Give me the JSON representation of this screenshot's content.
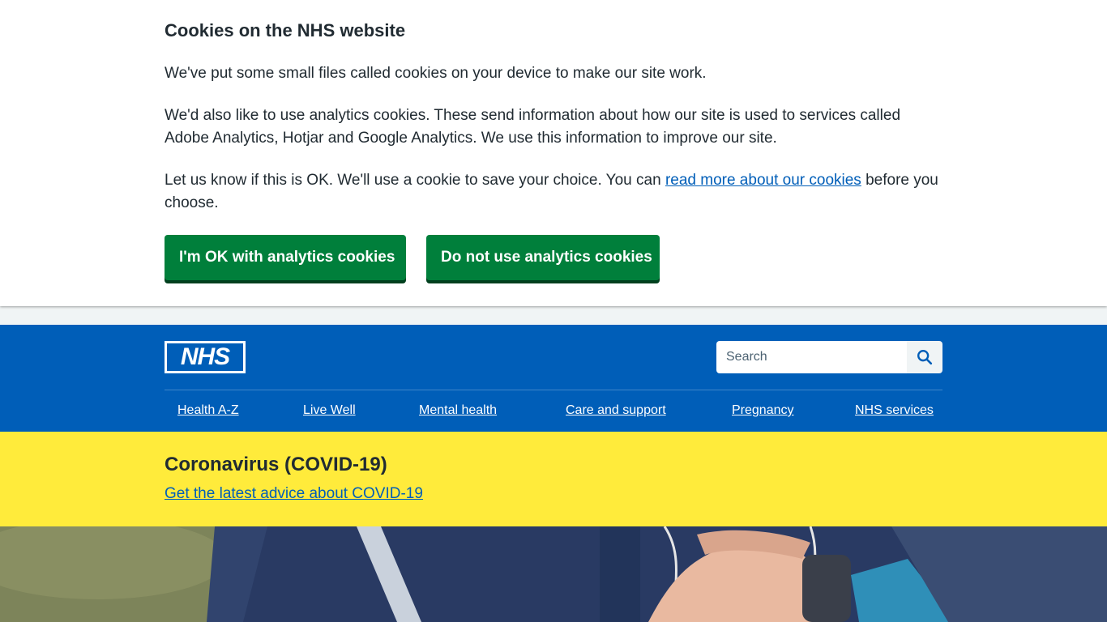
{
  "cookie_banner": {
    "title": "Cookies on the NHS website",
    "p1": "We've put some small files called cookies on your device to make our site work.",
    "p2": "We'd also like to use analytics cookies. These send information about how our site is used to services called Adobe Analytics, Hotjar and Google Analytics. We use this information to improve our site.",
    "p3_before": "Let us know if this is OK. We'll use a cookie to save your choice. You can ",
    "p3_link": "read more about our cookies",
    "p3_after": " before you choose.",
    "accept_label": "I'm OK with analytics cookies",
    "reject_label": "Do not use analytics cookies"
  },
  "header": {
    "logo_text": "NHS",
    "search": {
      "placeholder": "Search",
      "value": ""
    },
    "nav": [
      {
        "label": "Health A-Z"
      },
      {
        "label": "Live Well"
      },
      {
        "label": "Mental health"
      },
      {
        "label": "Care and support"
      },
      {
        "label": "Pregnancy"
      },
      {
        "label": "NHS services"
      }
    ]
  },
  "covid_banner": {
    "title": "Coronavirus (COVID-19)",
    "link": "Get the latest advice about COVID-19"
  },
  "colors": {
    "nhs_blue": "#005eb8",
    "button_green": "#007f3b",
    "covid_yellow": "#ffeb3b",
    "text": "#212b32"
  },
  "icons": {
    "search": "search-icon"
  }
}
